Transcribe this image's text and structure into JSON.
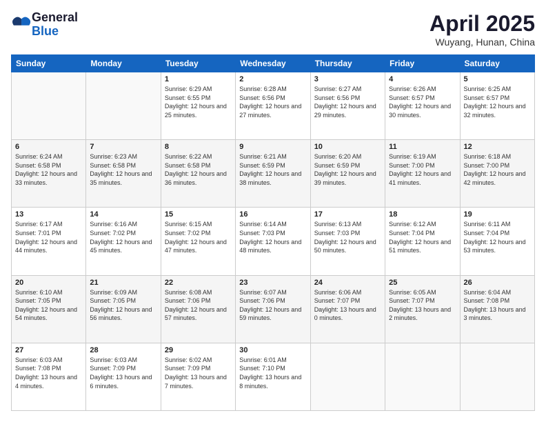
{
  "logo": {
    "general": "General",
    "blue": "Blue"
  },
  "title": "April 2025",
  "location": "Wuyang, Hunan, China",
  "days_of_week": [
    "Sunday",
    "Monday",
    "Tuesday",
    "Wednesday",
    "Thursday",
    "Friday",
    "Saturday"
  ],
  "weeks": [
    [
      {
        "day": "",
        "sunrise": "",
        "sunset": "",
        "daylight": "",
        "empty": true
      },
      {
        "day": "",
        "sunrise": "",
        "sunset": "",
        "daylight": "",
        "empty": true
      },
      {
        "day": "1",
        "sunrise": "Sunrise: 6:29 AM",
        "sunset": "Sunset: 6:55 PM",
        "daylight": "Daylight: 12 hours and 25 minutes."
      },
      {
        "day": "2",
        "sunrise": "Sunrise: 6:28 AM",
        "sunset": "Sunset: 6:56 PM",
        "daylight": "Daylight: 12 hours and 27 minutes."
      },
      {
        "day": "3",
        "sunrise": "Sunrise: 6:27 AM",
        "sunset": "Sunset: 6:56 PM",
        "daylight": "Daylight: 12 hours and 29 minutes."
      },
      {
        "day": "4",
        "sunrise": "Sunrise: 6:26 AM",
        "sunset": "Sunset: 6:57 PM",
        "daylight": "Daylight: 12 hours and 30 minutes."
      },
      {
        "day": "5",
        "sunrise": "Sunrise: 6:25 AM",
        "sunset": "Sunset: 6:57 PM",
        "daylight": "Daylight: 12 hours and 32 minutes."
      }
    ],
    [
      {
        "day": "6",
        "sunrise": "Sunrise: 6:24 AM",
        "sunset": "Sunset: 6:58 PM",
        "daylight": "Daylight: 12 hours and 33 minutes."
      },
      {
        "day": "7",
        "sunrise": "Sunrise: 6:23 AM",
        "sunset": "Sunset: 6:58 PM",
        "daylight": "Daylight: 12 hours and 35 minutes."
      },
      {
        "day": "8",
        "sunrise": "Sunrise: 6:22 AM",
        "sunset": "Sunset: 6:58 PM",
        "daylight": "Daylight: 12 hours and 36 minutes."
      },
      {
        "day": "9",
        "sunrise": "Sunrise: 6:21 AM",
        "sunset": "Sunset: 6:59 PM",
        "daylight": "Daylight: 12 hours and 38 minutes."
      },
      {
        "day": "10",
        "sunrise": "Sunrise: 6:20 AM",
        "sunset": "Sunset: 6:59 PM",
        "daylight": "Daylight: 12 hours and 39 minutes."
      },
      {
        "day": "11",
        "sunrise": "Sunrise: 6:19 AM",
        "sunset": "Sunset: 7:00 PM",
        "daylight": "Daylight: 12 hours and 41 minutes."
      },
      {
        "day": "12",
        "sunrise": "Sunrise: 6:18 AM",
        "sunset": "Sunset: 7:00 PM",
        "daylight": "Daylight: 12 hours and 42 minutes."
      }
    ],
    [
      {
        "day": "13",
        "sunrise": "Sunrise: 6:17 AM",
        "sunset": "Sunset: 7:01 PM",
        "daylight": "Daylight: 12 hours and 44 minutes."
      },
      {
        "day": "14",
        "sunrise": "Sunrise: 6:16 AM",
        "sunset": "Sunset: 7:02 PM",
        "daylight": "Daylight: 12 hours and 45 minutes."
      },
      {
        "day": "15",
        "sunrise": "Sunrise: 6:15 AM",
        "sunset": "Sunset: 7:02 PM",
        "daylight": "Daylight: 12 hours and 47 minutes."
      },
      {
        "day": "16",
        "sunrise": "Sunrise: 6:14 AM",
        "sunset": "Sunset: 7:03 PM",
        "daylight": "Daylight: 12 hours and 48 minutes."
      },
      {
        "day": "17",
        "sunrise": "Sunrise: 6:13 AM",
        "sunset": "Sunset: 7:03 PM",
        "daylight": "Daylight: 12 hours and 50 minutes."
      },
      {
        "day": "18",
        "sunrise": "Sunrise: 6:12 AM",
        "sunset": "Sunset: 7:04 PM",
        "daylight": "Daylight: 12 hours and 51 minutes."
      },
      {
        "day": "19",
        "sunrise": "Sunrise: 6:11 AM",
        "sunset": "Sunset: 7:04 PM",
        "daylight": "Daylight: 12 hours and 53 minutes."
      }
    ],
    [
      {
        "day": "20",
        "sunrise": "Sunrise: 6:10 AM",
        "sunset": "Sunset: 7:05 PM",
        "daylight": "Daylight: 12 hours and 54 minutes."
      },
      {
        "day": "21",
        "sunrise": "Sunrise: 6:09 AM",
        "sunset": "Sunset: 7:05 PM",
        "daylight": "Daylight: 12 hours and 56 minutes."
      },
      {
        "day": "22",
        "sunrise": "Sunrise: 6:08 AM",
        "sunset": "Sunset: 7:06 PM",
        "daylight": "Daylight: 12 hours and 57 minutes."
      },
      {
        "day": "23",
        "sunrise": "Sunrise: 6:07 AM",
        "sunset": "Sunset: 7:06 PM",
        "daylight": "Daylight: 12 hours and 59 minutes."
      },
      {
        "day": "24",
        "sunrise": "Sunrise: 6:06 AM",
        "sunset": "Sunset: 7:07 PM",
        "daylight": "Daylight: 13 hours and 0 minutes."
      },
      {
        "day": "25",
        "sunrise": "Sunrise: 6:05 AM",
        "sunset": "Sunset: 7:07 PM",
        "daylight": "Daylight: 13 hours and 2 minutes."
      },
      {
        "day": "26",
        "sunrise": "Sunrise: 6:04 AM",
        "sunset": "Sunset: 7:08 PM",
        "daylight": "Daylight: 13 hours and 3 minutes."
      }
    ],
    [
      {
        "day": "27",
        "sunrise": "Sunrise: 6:03 AM",
        "sunset": "Sunset: 7:08 PM",
        "daylight": "Daylight: 13 hours and 4 minutes."
      },
      {
        "day": "28",
        "sunrise": "Sunrise: 6:03 AM",
        "sunset": "Sunset: 7:09 PM",
        "daylight": "Daylight: 13 hours and 6 minutes."
      },
      {
        "day": "29",
        "sunrise": "Sunrise: 6:02 AM",
        "sunset": "Sunset: 7:09 PM",
        "daylight": "Daylight: 13 hours and 7 minutes."
      },
      {
        "day": "30",
        "sunrise": "Sunrise: 6:01 AM",
        "sunset": "Sunset: 7:10 PM",
        "daylight": "Daylight: 13 hours and 8 minutes."
      },
      {
        "day": "",
        "sunrise": "",
        "sunset": "",
        "daylight": "",
        "empty": true
      },
      {
        "day": "",
        "sunrise": "",
        "sunset": "",
        "daylight": "",
        "empty": true
      },
      {
        "day": "",
        "sunrise": "",
        "sunset": "",
        "daylight": "",
        "empty": true
      }
    ]
  ]
}
